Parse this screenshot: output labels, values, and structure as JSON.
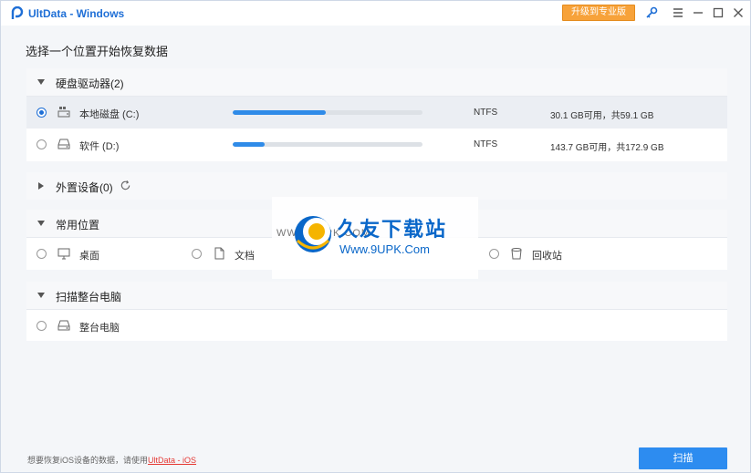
{
  "window": {
    "title": "UltData - Windows",
    "upgrade_label": "升级到专业版",
    "icons": [
      "key-icon",
      "menu-icon",
      "minimize-icon",
      "maximize-icon",
      "close-icon"
    ]
  },
  "heading": "选择一个位置开始恢复数据",
  "sections": {
    "drives": {
      "label": "硬盘驱动器(2)",
      "items": [
        {
          "name": "本地磁盘 (C:)",
          "fs": "NTFS",
          "capacity": "30.1 GB可用，共59.1 GB",
          "used_fraction": 0.49,
          "selected": true,
          "icon": "windows-drive-icon"
        },
        {
          "name": "软件 (D:)",
          "fs": "NTFS",
          "capacity": "143.7 GB可用，共172.9 GB",
          "used_fraction": 0.17,
          "selected": false,
          "icon": "drive-icon"
        }
      ]
    },
    "external": {
      "label": "外置设备(0)",
      "refresh_icon": "refresh-icon"
    },
    "common": {
      "label": "常用位置",
      "items": [
        {
          "name": "桌面",
          "icon": "desktop-icon"
        },
        {
          "name": "文档",
          "icon": "document-icon"
        },
        {
          "name": "回收站",
          "icon": "recycle-bin-icon"
        }
      ]
    },
    "whole": {
      "label": "扫描整台电脑",
      "items": [
        {
          "name": "整台电脑",
          "icon": "drive-icon"
        }
      ]
    }
  },
  "footer": {
    "note": "想要恢复iOS设备的数据，请使用",
    "link": "UltData - iOS",
    "scan_label": "扫描"
  },
  "watermark": {
    "small": "WWW.9UPK.COM",
    "big": "久友下载站",
    "url": "Www.9UPK.Com"
  },
  "colors": {
    "accent": "#2d8cf0",
    "upgrade": "#f7a23a",
    "link": "#e53935"
  }
}
